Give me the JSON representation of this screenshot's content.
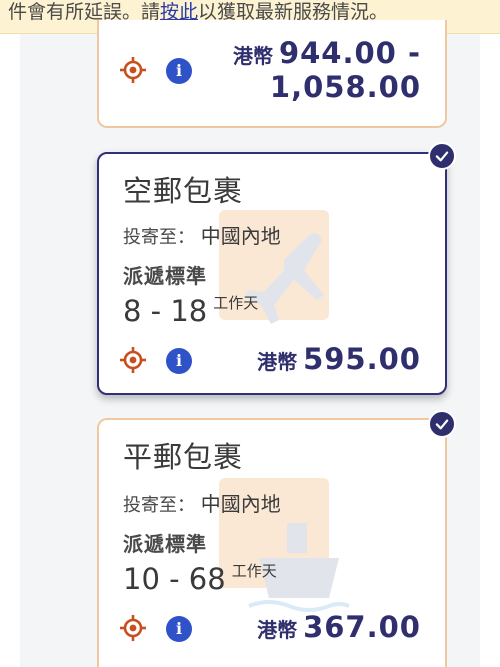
{
  "notice": {
    "text_before": "件會有所延誤。請",
    "link_text": "按此",
    "text_after": "以獲取最新服務情況。"
  },
  "cards": [
    {
      "price_currency": "港幣",
      "price_line1": "944.00 -",
      "price_line2": "1,058.00",
      "selected": false
    },
    {
      "title": "空郵包裹",
      "dest_label": "投寄至：",
      "dest_value": "中國內地",
      "standard_label": "派遞標準",
      "days_range": "8 - 18",
      "days_unit": "工作天",
      "price_currency": "港幣",
      "price": "595.00",
      "selected": true,
      "watermark_icon": "airplane-icon"
    },
    {
      "title": "平郵包裹",
      "dest_label": "投寄至：",
      "dest_value": "中國內地",
      "standard_label": "派遞標準",
      "days_range": "10 - 68",
      "days_unit": "工作天",
      "price_currency": "港幣",
      "price": "367.00",
      "selected": false,
      "watermark_icon": "ship-icon"
    }
  ],
  "colors": {
    "accent_navy": "#2f2f6e",
    "card_border": "#f0c8a0",
    "info_blue": "#2f52c8",
    "location_orange": "#c8501e",
    "notice_bg": "#fdf3d3"
  }
}
